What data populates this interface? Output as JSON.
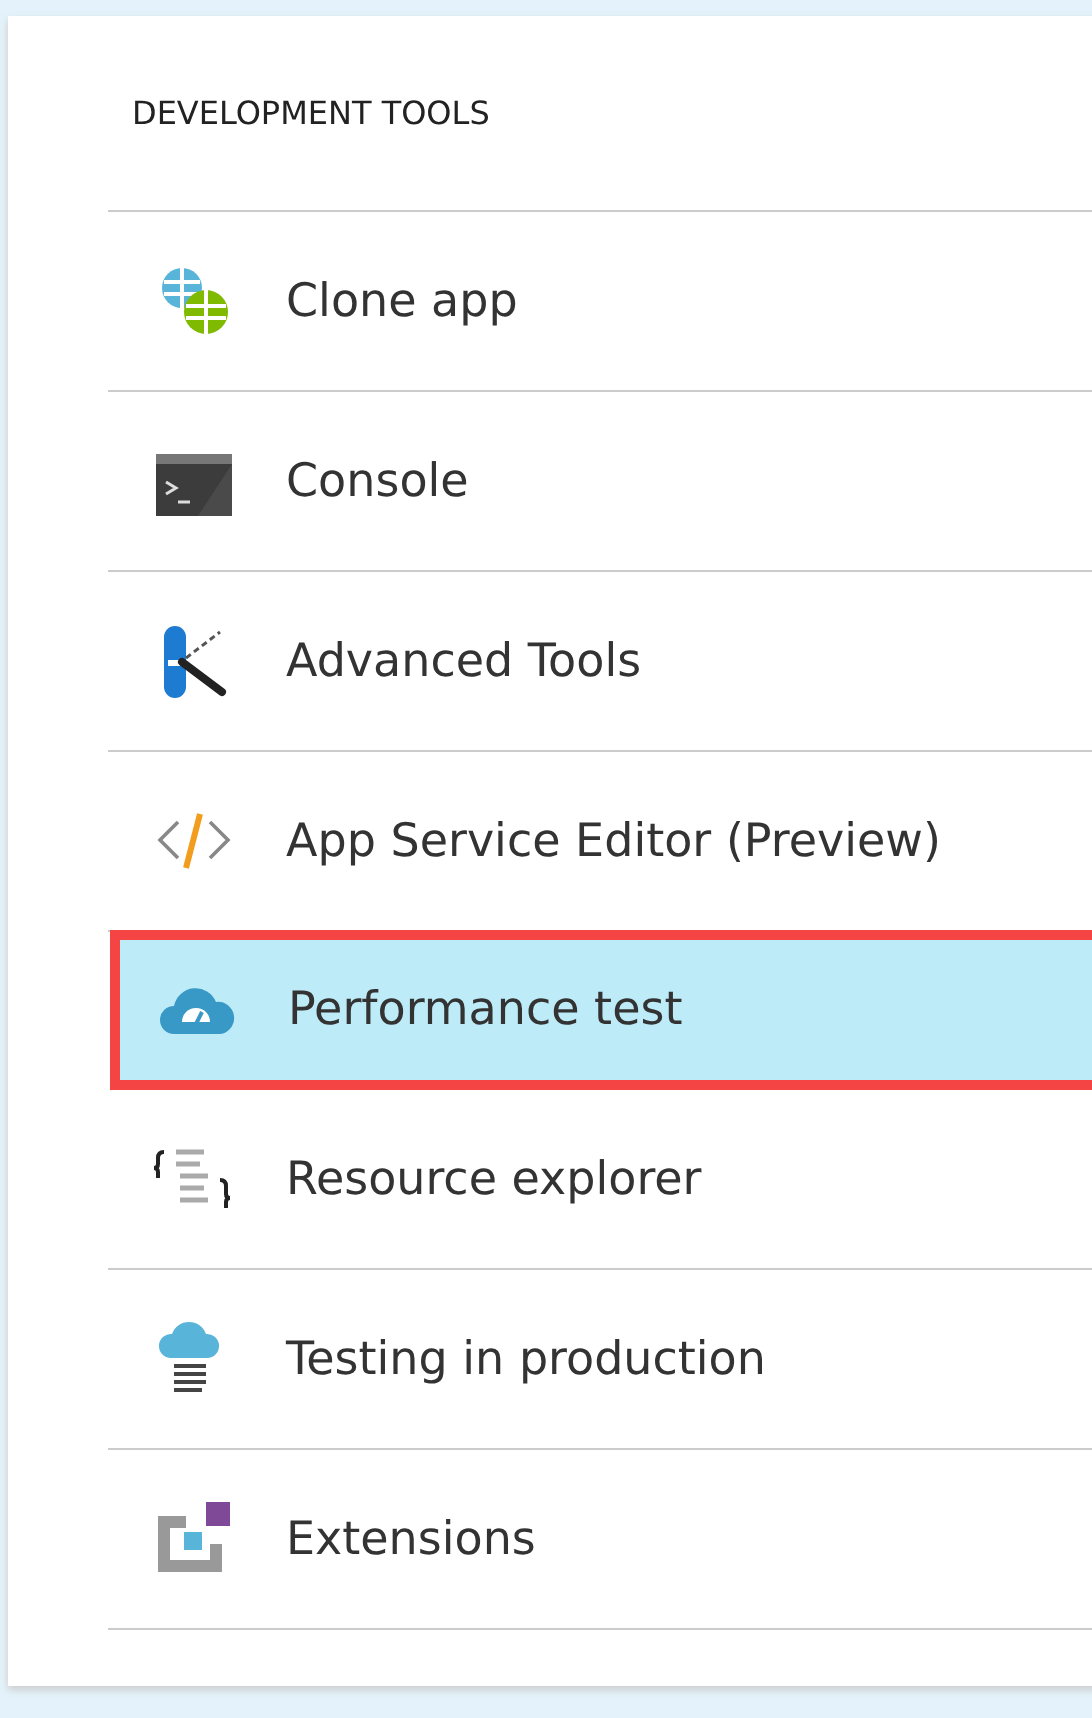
{
  "section": {
    "title": "DEVELOPMENT TOOLS"
  },
  "items": [
    {
      "label": "Clone app",
      "selected": false
    },
    {
      "label": "Console",
      "selected": false
    },
    {
      "label": "Advanced Tools",
      "selected": false
    },
    {
      "label": "App Service Editor (Preview)",
      "selected": false
    },
    {
      "label": "Performance test",
      "selected": true
    },
    {
      "label": "Resource explorer",
      "selected": false
    },
    {
      "label": "Testing in production",
      "selected": false
    },
    {
      "label": "Extensions",
      "selected": false
    }
  ]
}
